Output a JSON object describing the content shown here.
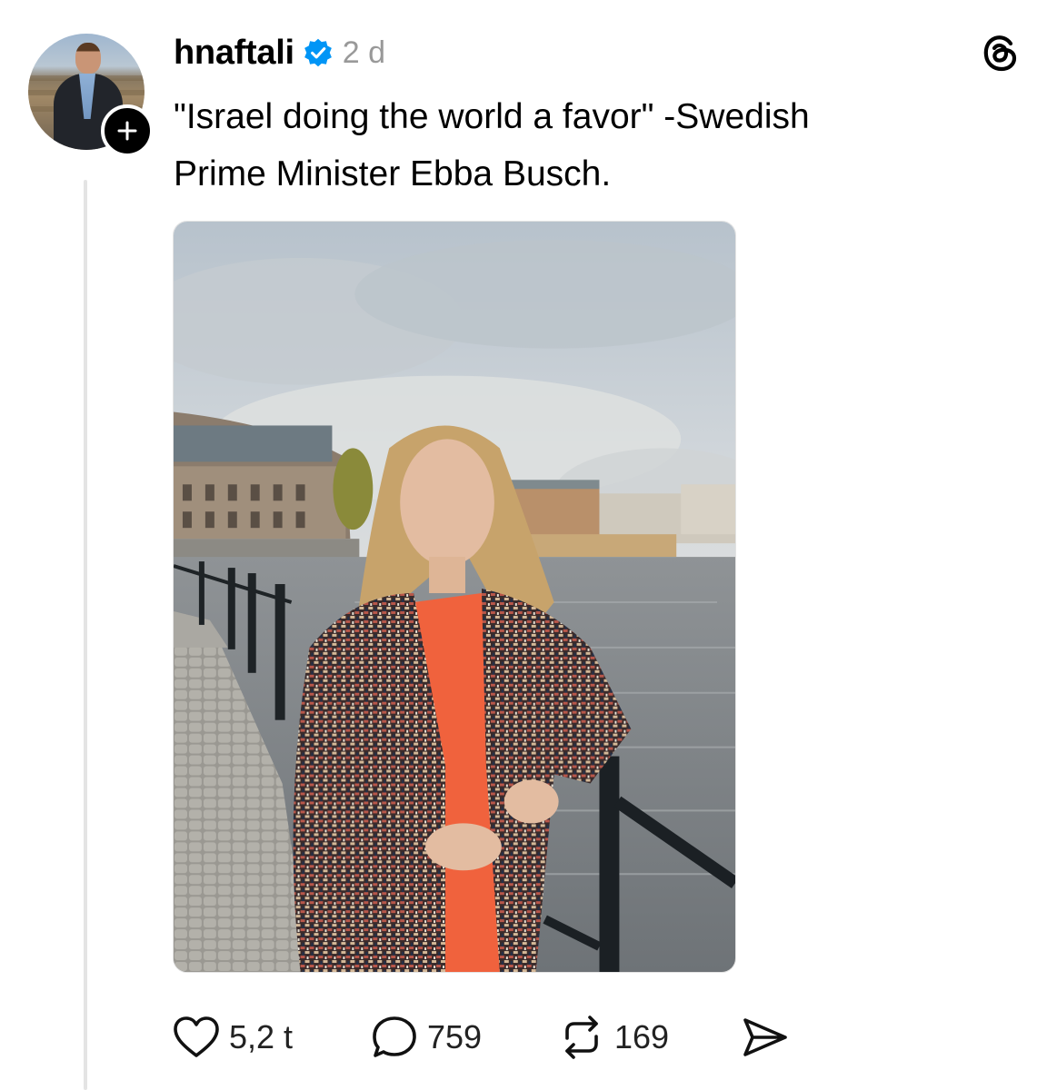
{
  "post": {
    "username": "hnaftali",
    "verified": true,
    "time": "2 d",
    "text_line1": "\"Israel doing the world a favor\" -Swedish",
    "text_line2": "Prime Minister Ebba Busch."
  },
  "stats": {
    "likes": "5,2 t",
    "replies": "759",
    "reposts": "169"
  },
  "colors": {
    "verified_blue": "#0095f6",
    "muted_text": "#999999",
    "thread_line": "#e4e4e4"
  },
  "icons": {
    "follow": "plus-icon",
    "brand": "threads-logo-icon",
    "like": "heart-icon",
    "reply": "speech-bubble-icon",
    "repost": "repost-icon",
    "share": "send-icon"
  }
}
